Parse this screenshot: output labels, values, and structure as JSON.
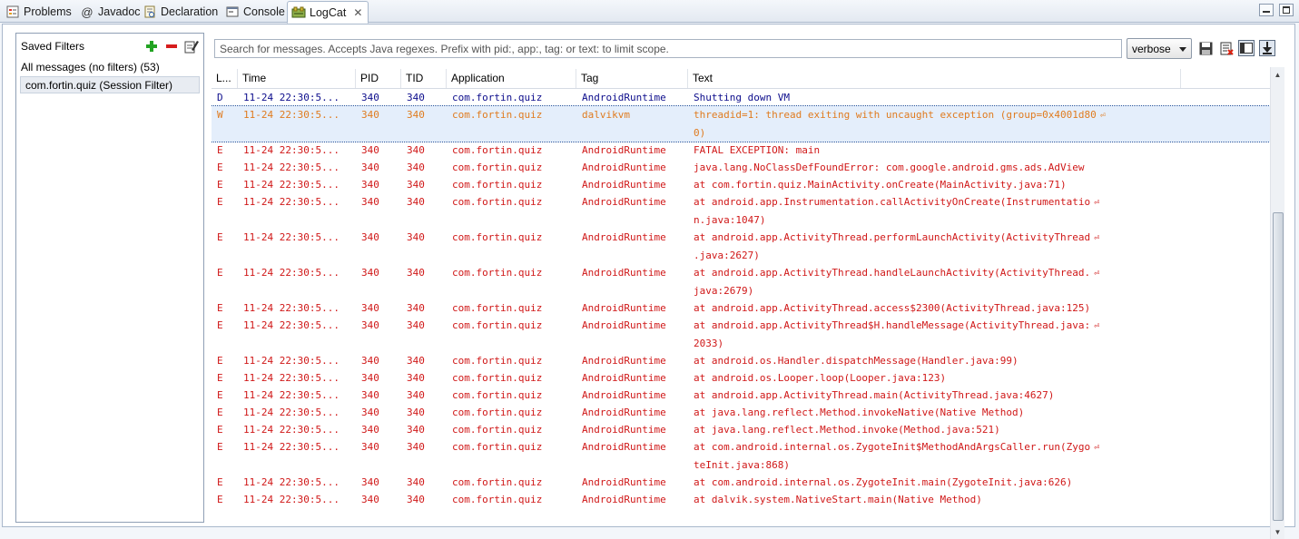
{
  "tabs": [
    {
      "label": "Problems",
      "icon": "problems-icon"
    },
    {
      "label": "Javadoc",
      "icon": "javadoc-icon"
    },
    {
      "label": "Declaration",
      "icon": "declaration-icon"
    },
    {
      "label": "Console",
      "icon": "console-icon"
    },
    {
      "label": "LogCat",
      "icon": "logcat-icon",
      "active": true,
      "close": "✕"
    }
  ],
  "filters": {
    "title": "Saved Filters",
    "items": [
      {
        "label": "All messages (no filters) (53)"
      },
      {
        "label": "com.fortin.quiz (Session Filter)",
        "selected": true
      }
    ]
  },
  "search": {
    "placeholder": "Search for messages. Accepts Java regexes. Prefix with pid:, app:, tag: or text: to limit scope."
  },
  "level_select": {
    "value": "verbose"
  },
  "columns": [
    "L...",
    "Time",
    "PID",
    "TID",
    "Application",
    "Tag",
    "Text"
  ],
  "colors": {
    "debug": "#0d0d8c",
    "warn": "#e07b1f",
    "error": "#d01818"
  },
  "rows": [
    {
      "level": "D",
      "time": "11-24 22:30:5...",
      "pid": "340",
      "tid": "340",
      "app": "com.fortin.quiz",
      "tag": "AndroidRuntime",
      "text": [
        "Shutting down VM"
      ]
    },
    {
      "level": "W",
      "time": "11-24 22:30:5...",
      "pid": "340",
      "tid": "340",
      "app": "com.fortin.quiz",
      "tag": "dalvikvm",
      "text": [
        "threadid=1: thread exiting with uncaught exception (group=0x4001d80",
        "0)"
      ],
      "selected": true
    },
    {
      "level": "E",
      "time": "11-24 22:30:5...",
      "pid": "340",
      "tid": "340",
      "app": "com.fortin.quiz",
      "tag": "AndroidRuntime",
      "text": [
        "FATAL EXCEPTION: main"
      ]
    },
    {
      "level": "E",
      "time": "11-24 22:30:5...",
      "pid": "340",
      "tid": "340",
      "app": "com.fortin.quiz",
      "tag": "AndroidRuntime",
      "text": [
        "java.lang.NoClassDefFoundError: com.google.android.gms.ads.AdView"
      ]
    },
    {
      "level": "E",
      "time": "11-24 22:30:5...",
      "pid": "340",
      "tid": "340",
      "app": "com.fortin.quiz",
      "tag": "AndroidRuntime",
      "text": [
        "at com.fortin.quiz.MainActivity.onCreate(MainActivity.java:71)"
      ]
    },
    {
      "level": "E",
      "time": "11-24 22:30:5...",
      "pid": "340",
      "tid": "340",
      "app": "com.fortin.quiz",
      "tag": "AndroidRuntime",
      "text": [
        "at android.app.Instrumentation.callActivityOnCreate(Instrumentatio",
        "n.java:1047)"
      ]
    },
    {
      "level": "E",
      "time": "11-24 22:30:5...",
      "pid": "340",
      "tid": "340",
      "app": "com.fortin.quiz",
      "tag": "AndroidRuntime",
      "text": [
        "at android.app.ActivityThread.performLaunchActivity(ActivityThread",
        ".java:2627)"
      ]
    },
    {
      "level": "E",
      "time": "11-24 22:30:5...",
      "pid": "340",
      "tid": "340",
      "app": "com.fortin.quiz",
      "tag": "AndroidRuntime",
      "text": [
        "at android.app.ActivityThread.handleLaunchActivity(ActivityThread.",
        "java:2679)"
      ]
    },
    {
      "level": "E",
      "time": "11-24 22:30:5...",
      "pid": "340",
      "tid": "340",
      "app": "com.fortin.quiz",
      "tag": "AndroidRuntime",
      "text": [
        "at android.app.ActivityThread.access$2300(ActivityThread.java:125)"
      ]
    },
    {
      "level": "E",
      "time": "11-24 22:30:5...",
      "pid": "340",
      "tid": "340",
      "app": "com.fortin.quiz",
      "tag": "AndroidRuntime",
      "text": [
        "at android.app.ActivityThread$H.handleMessage(ActivityThread.java:",
        "2033)"
      ]
    },
    {
      "level": "E",
      "time": "11-24 22:30:5...",
      "pid": "340",
      "tid": "340",
      "app": "com.fortin.quiz",
      "tag": "AndroidRuntime",
      "text": [
        "at android.os.Handler.dispatchMessage(Handler.java:99)"
      ]
    },
    {
      "level": "E",
      "time": "11-24 22:30:5...",
      "pid": "340",
      "tid": "340",
      "app": "com.fortin.quiz",
      "tag": "AndroidRuntime",
      "text": [
        "at android.os.Looper.loop(Looper.java:123)"
      ]
    },
    {
      "level": "E",
      "time": "11-24 22:30:5...",
      "pid": "340",
      "tid": "340",
      "app": "com.fortin.quiz",
      "tag": "AndroidRuntime",
      "text": [
        "at android.app.ActivityThread.main(ActivityThread.java:4627)"
      ]
    },
    {
      "level": "E",
      "time": "11-24 22:30:5...",
      "pid": "340",
      "tid": "340",
      "app": "com.fortin.quiz",
      "tag": "AndroidRuntime",
      "text": [
        "at java.lang.reflect.Method.invokeNative(Native Method)"
      ]
    },
    {
      "level": "E",
      "time": "11-24 22:30:5...",
      "pid": "340",
      "tid": "340",
      "app": "com.fortin.quiz",
      "tag": "AndroidRuntime",
      "text": [
        "at java.lang.reflect.Method.invoke(Method.java:521)"
      ]
    },
    {
      "level": "E",
      "time": "11-24 22:30:5...",
      "pid": "340",
      "tid": "340",
      "app": "com.fortin.quiz",
      "tag": "AndroidRuntime",
      "text": [
        "at com.android.internal.os.ZygoteInit$MethodAndArgsCaller.run(Zygo",
        "teInit.java:868)"
      ]
    },
    {
      "level": "E",
      "time": "11-24 22:30:5...",
      "pid": "340",
      "tid": "340",
      "app": "com.fortin.quiz",
      "tag": "AndroidRuntime",
      "text": [
        "at com.android.internal.os.ZygoteInit.main(ZygoteInit.java:626)"
      ]
    },
    {
      "level": "E",
      "time": "11-24 22:30:5...",
      "pid": "340",
      "tid": "340",
      "app": "com.fortin.quiz",
      "tag": "AndroidRuntime",
      "text": [
        "at dalvik.system.NativeStart.main(Native Method)"
      ]
    }
  ],
  "wrap_glyph": "⏎"
}
